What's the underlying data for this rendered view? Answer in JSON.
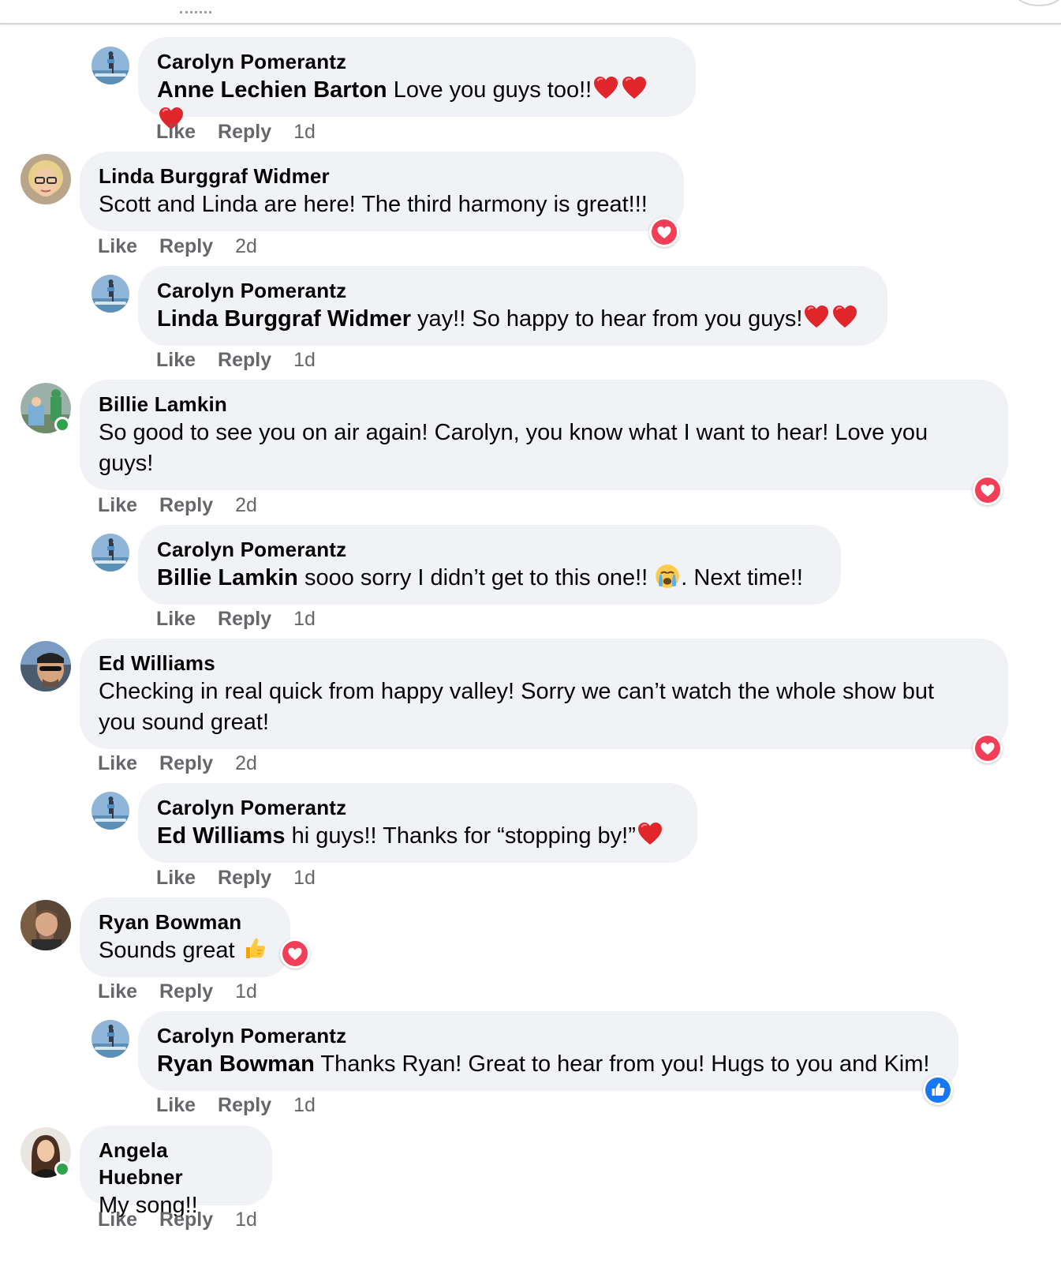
{
  "colors": {
    "bubble": "#f0f2f5",
    "meta": "#65676b",
    "love": "#f33e58",
    "like": "#1877f2",
    "online": "#31a24c"
  },
  "actions": {
    "like": "Like",
    "reply": "Reply"
  },
  "comments": [
    {
      "author": "Carolyn Pomerantz",
      "mention": "Anne Lechien Barton",
      "text": "Love you guys too!!",
      "emoji": "❤️❤️❤️",
      "time": "1d"
    },
    {
      "author": "Linda Burggraf Widmer",
      "text": "Scott and Linda are here! The third harmony is great!!!",
      "time": "2d",
      "reaction": "love"
    },
    {
      "author": "Carolyn Pomerantz",
      "mention": "Linda Burggraf Widmer",
      "text": "yay!! So happy to hear from you guys!",
      "emoji": "❤️❤️",
      "time": "1d"
    },
    {
      "author": "Billie Lamkin",
      "text_line1": "So good to see you on air again! Carolyn, you know what I want to hear! Love you",
      "text_line2": "guys!",
      "time": "2d",
      "reaction": "love",
      "online": true
    },
    {
      "author": "Carolyn Pomerantz",
      "mention": "Billie Lamkin",
      "text": "sooo sorry I didn’t get to this one!! ",
      "emoji": "😭",
      "text_after": ". Next time!!",
      "time": "1d"
    },
    {
      "author": "Ed Williams",
      "text_line1": "Checking in real quick from happy valley! Sorry we can’t watch the whole show but",
      "text_line2": "you sound great!",
      "time": "2d",
      "reaction": "love"
    },
    {
      "author": "Carolyn Pomerantz",
      "mention": "Ed Williams",
      "text": "hi guys!! Thanks for “stopping by!”",
      "emoji": "❤️",
      "time": "1d"
    },
    {
      "author": "Ryan Bowman",
      "text": "Sounds great ",
      "emoji": "👍",
      "time": "1d",
      "reaction": "love"
    },
    {
      "author": "Carolyn Pomerantz",
      "mention": "Ryan Bowman",
      "text": "Thanks Ryan! Great to hear from you! Hugs to you and Kim!",
      "time": "1d",
      "reaction": "like"
    },
    {
      "author": "Angela Huebner",
      "text": "My song!!",
      "time": "1d",
      "online": true
    }
  ]
}
